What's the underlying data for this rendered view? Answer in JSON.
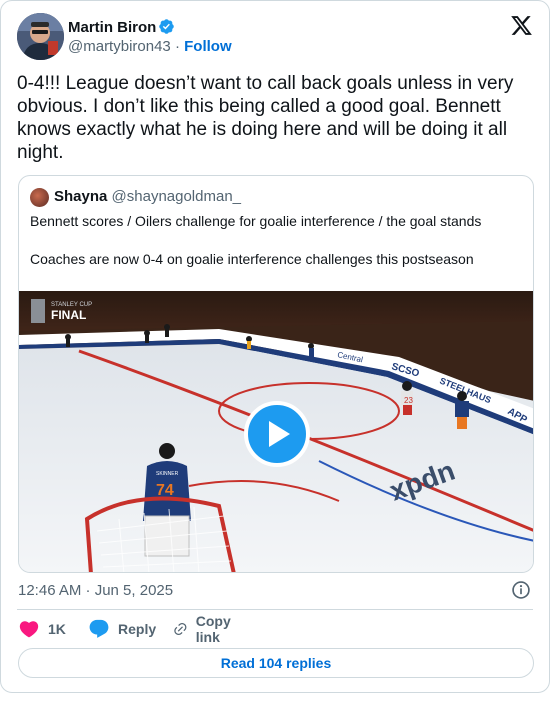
{
  "author": {
    "name": "Martin Biron",
    "handle": "@martybiron43",
    "separator": "·",
    "follow_label": "Follow",
    "verified": true
  },
  "tweet": {
    "text": "0-4!!! League doesn’t want to call back goals unless in very obvious. I don’t like this being called a good goal. Bennett knows exactly what he is doing here and will be doing it all night."
  },
  "quoted_tweet": {
    "name": "Shayna",
    "handle": "@shaynagoldman_",
    "line1": "Bennett scores / Oilers challenge for goalie interference / the goal stands",
    "line2": "Coaches are now 0-4 on goalie interference challenges this postseason",
    "video_overlay": {
      "badge_top": "STANLEY CUP",
      "badge_bottom": "FINAL",
      "board_ad_1": "Central",
      "board_ad_2": "SCSO",
      "board_ad_3": "STEELHAUS",
      "board_ad_4": "APP",
      "ice_logo": "xpdn",
      "goalie_name": "SKINNER",
      "goalie_number": "74",
      "skater_number": "23"
    }
  },
  "meta": {
    "timestamp": "12:46 AM · Jun 5, 2025"
  },
  "actions": {
    "like_count": "1K",
    "reply_label": "Reply",
    "copy_label": "Copy link",
    "read_replies_label": "Read 104 replies"
  },
  "colors": {
    "link_blue": "#006fd6",
    "play_blue": "#1d9bf0",
    "heart_red": "#f91880",
    "secondary_text": "#536471",
    "border": "#cfd9de"
  },
  "icons": {
    "verified": "verified-badge-icon",
    "platform": "x-logo-icon",
    "info": "info-icon",
    "like": "heart-icon",
    "reply": "speech-bubble-icon",
    "copy": "link-icon",
    "play": "play-icon"
  }
}
